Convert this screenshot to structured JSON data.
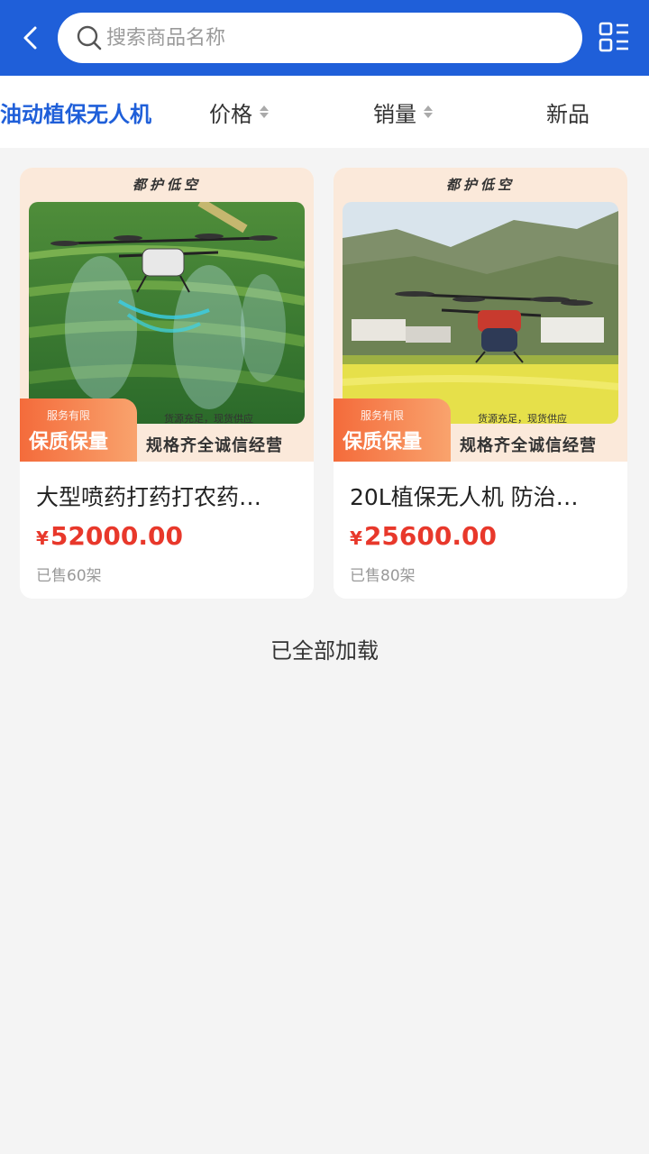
{
  "search": {
    "placeholder": "搜索商品名称"
  },
  "sort": {
    "category": "油动植保无人机",
    "price": "价格",
    "sales": "销量",
    "newest": "新品"
  },
  "products": [
    {
      "banner": "都护低空",
      "badge_small": "服务有限",
      "badge_big": "保质保量",
      "supply": "货源充足，现货供应",
      "slogan": "规格齐全诚信经营",
      "title": "大型喷药打药打农药…",
      "currency": "¥",
      "price": "52000.00",
      "sold": "已售60架"
    },
    {
      "banner": "都护低空",
      "badge_small": "服务有限",
      "badge_big": "保质保量",
      "supply": "货源充足，现货供应",
      "slogan": "规格齐全诚信经营",
      "title": "20L植保无人机 防治…",
      "currency": "¥",
      "price": "25600.00",
      "sold": "已售80架"
    }
  ],
  "footer": {
    "loaded_text": "已全部加载"
  },
  "colors": {
    "brand": "#1f5fd9",
    "price": "#e8382b",
    "badge": "#f46b3b"
  }
}
